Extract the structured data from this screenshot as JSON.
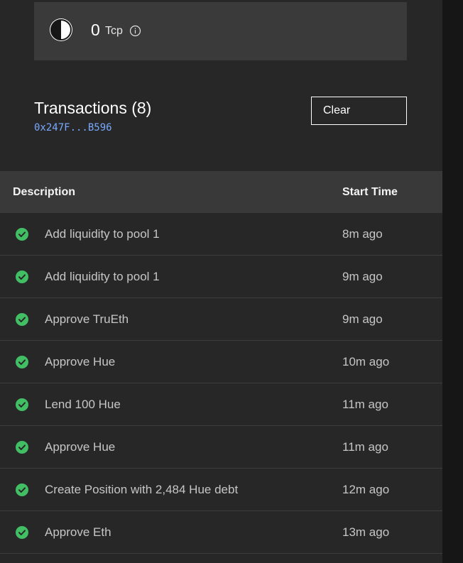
{
  "balance": {
    "amount": "0",
    "unit": "Tcp",
    "token_icon": "half-moon-icon",
    "info_icon": "info-icon"
  },
  "transactions": {
    "title": "Transactions (8)",
    "address": "0x247F...B596",
    "clear_label": "Clear",
    "columns": {
      "description": "Description",
      "start_time": "Start Time"
    },
    "status_icon": "check-circle-icon",
    "status_color": "#42be65",
    "rows": [
      {
        "description": "Add liquidity to pool 1",
        "start_time": "8m ago"
      },
      {
        "description": "Add liquidity to pool 1",
        "start_time": "9m ago"
      },
      {
        "description": "Approve TruEth",
        "start_time": "9m ago"
      },
      {
        "description": "Approve Hue",
        "start_time": "10m ago"
      },
      {
        "description": "Lend 100 Hue",
        "start_time": "11m ago"
      },
      {
        "description": "Approve Hue",
        "start_time": "11m ago"
      },
      {
        "description": "Create Position with 2,484 Hue debt",
        "start_time": "12m ago"
      },
      {
        "description": "Approve Eth",
        "start_time": "13m ago"
      }
    ]
  },
  "colors": {
    "panel_bg": "#272727",
    "card_bg": "#3a3a3a",
    "header_bg": "#393939",
    "address_link": "#78a9ff"
  }
}
